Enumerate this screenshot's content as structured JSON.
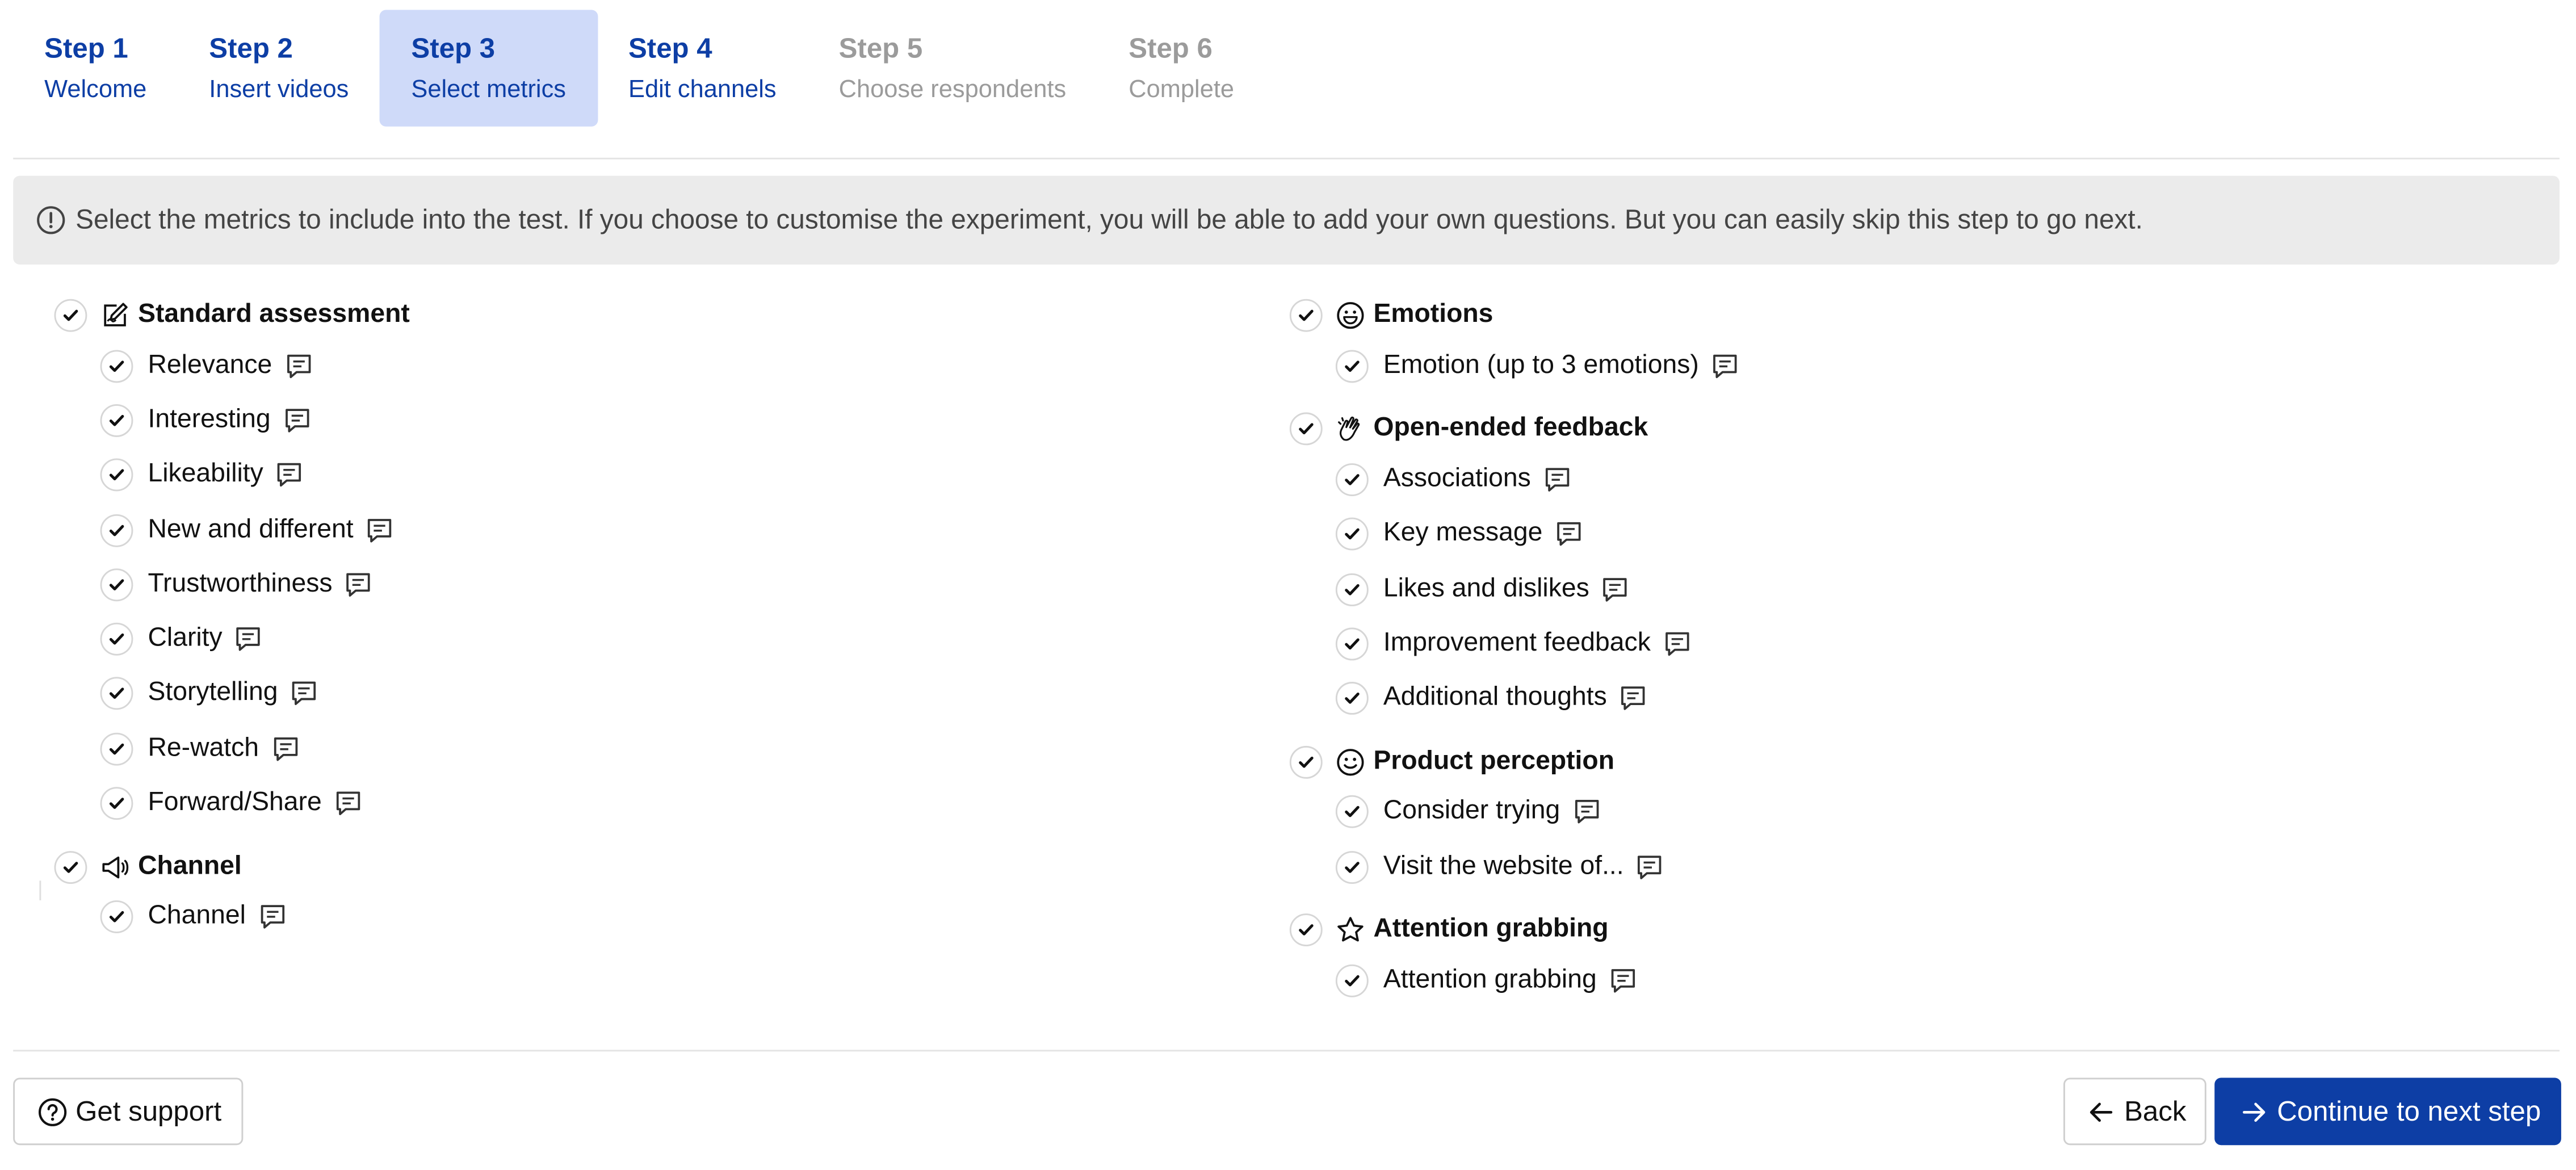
{
  "steps": [
    {
      "num": "Step 1",
      "name": "Welcome",
      "state": "done"
    },
    {
      "num": "Step 2",
      "name": "Insert videos",
      "state": "done"
    },
    {
      "num": "Step 3",
      "name": "Select metrics",
      "state": "active"
    },
    {
      "num": "Step 4",
      "name": "Edit channels",
      "state": "done"
    },
    {
      "num": "Step 5",
      "name": "Choose respondents",
      "state": "disabled"
    },
    {
      "num": "Step 6",
      "name": "Complete",
      "state": "disabled"
    }
  ],
  "notice": {
    "icon": "exclamation-circle-icon",
    "text": "Select the metrics to include into the test. If you choose to customise the experiment, you will be able to add your own questions. But you can easily skip this step to go next."
  },
  "groups_left": [
    {
      "title": "Standard assessment",
      "icon": "pencil-square-icon",
      "checked": true,
      "items": [
        "Relevance",
        "Interesting",
        "Likeability",
        "New and different",
        "Trustworthiness",
        "Clarity",
        "Storytelling",
        "Re-watch",
        "Forward/Share"
      ]
    },
    {
      "title": "Channel",
      "icon": "megaphone-icon",
      "checked": true,
      "items": [
        "Channel"
      ]
    }
  ],
  "groups_right": [
    {
      "title": "Emotions",
      "icon": "smile-icon",
      "checked": true,
      "items": [
        "Emotion (up to 3 emotions)"
      ]
    },
    {
      "title": "Open-ended feedback",
      "icon": "clapping-hands-icon",
      "checked": true,
      "items": [
        "Associations",
        "Key message",
        "Likes and dislikes",
        "Improvement feedback",
        "Additional thoughts"
      ]
    },
    {
      "title": "Product perception",
      "icon": "smiley-icon",
      "checked": true,
      "items": [
        "Consider trying",
        "Visit the website of..."
      ]
    },
    {
      "title": "Attention grabbing",
      "icon": "star-icon",
      "checked": true,
      "items": [
        "Attention grabbing"
      ]
    }
  ],
  "footer": {
    "support_label": "Get support",
    "back_label": "Back",
    "next_label": "Continue to next step"
  },
  "colors": {
    "accent": "#0d3ea5",
    "active_step_bg": "#cfdaf9",
    "notice_bg": "#ebebeb"
  }
}
